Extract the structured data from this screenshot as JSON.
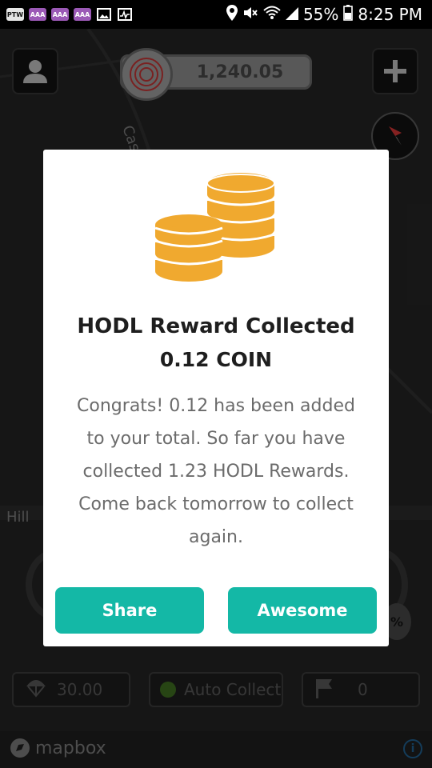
{
  "status_bar": {
    "notification_icons": [
      "PTW",
      "AAA",
      "AAA",
      "AAA"
    ],
    "battery": "55%",
    "time": "8:25 PM"
  },
  "map": {
    "balance": "1,240.05",
    "street_label_1": "Cast",
    "street_label_2": "Hill"
  },
  "dialog": {
    "title": "HODL Reward Collected",
    "amount": "0.12 COIN",
    "body_lines": [
      "Congrats! 0.12 has been added",
      "to your total. So far you have",
      "collected 1.23 HODL Rewards.",
      "Come back tomorrow to collect",
      "again."
    ],
    "share_label": "Share",
    "awesome_label": "Awesome"
  },
  "bottom_bar": {
    "left_value": "30.00",
    "auto_collect_label": "Auto Collect",
    "flag_value": "0",
    "partial_percent": "%"
  },
  "footer": {
    "brand": "mapbox",
    "info": "i"
  },
  "colors": {
    "accent": "#14b8a6",
    "coin": "#f0a92f",
    "map_bg": "#232323"
  }
}
